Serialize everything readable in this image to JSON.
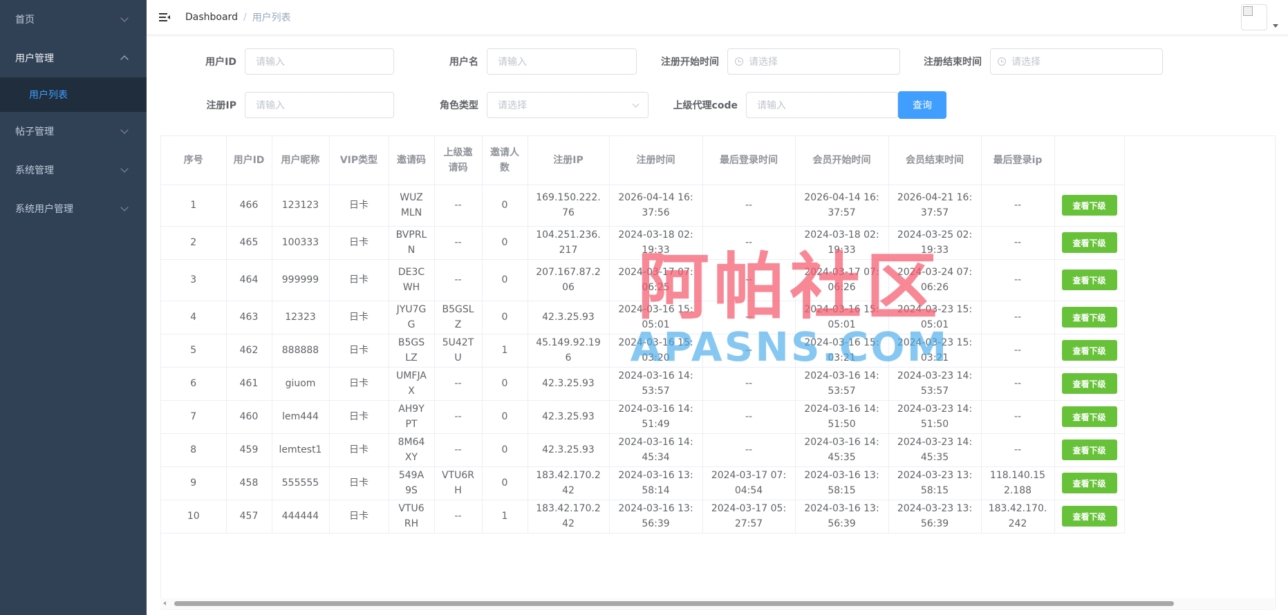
{
  "sidebar": {
    "items": [
      {
        "label": "首页"
      },
      {
        "label": "用户管理",
        "children": [
          {
            "label": "用户列表"
          }
        ]
      },
      {
        "label": "帖子管理"
      },
      {
        "label": "系统管理"
      },
      {
        "label": "系统用户管理"
      }
    ]
  },
  "navbar": {
    "breadcrumb": [
      "Dashboard",
      "/",
      "用户列表"
    ]
  },
  "filters": {
    "user_id": {
      "label": "用户ID",
      "placeholder": "请输入"
    },
    "username": {
      "label": "用户名",
      "placeholder": "请输入"
    },
    "reg_start": {
      "label": "注册开始时间",
      "placeholder": "请选择"
    },
    "reg_end": {
      "label": "注册结束时间",
      "placeholder": "请选择"
    },
    "reg_ip": {
      "label": "注册IP",
      "placeholder": "请输入"
    },
    "role_type": {
      "label": "角色类型",
      "placeholder": "请选择"
    },
    "agent_code": {
      "label": "上级代理code",
      "placeholder": "请输入"
    },
    "search_label": "查询"
  },
  "table": {
    "headers": [
      "序号",
      "用户ID",
      "用户昵称",
      "VIP类型",
      "邀请码",
      "上级邀请码",
      "邀请人数",
      "注册IP",
      "注册时间",
      "最后登录时间",
      "会员开始时间",
      "会员结束时间",
      "最后登录ip",
      ""
    ],
    "action_label": "查看下级",
    "rows": [
      [
        "1",
        "466",
        "123123",
        "日卡",
        "WUZMLN",
        "--",
        "0",
        "169.150.222.76",
        "2026-04-14 16:37:56",
        "--",
        "2026-04-14 16:37:57",
        "2026-04-21 16:37:57",
        "--"
      ],
      [
        "2",
        "465",
        "100333",
        "日卡",
        "BVPRLN",
        "--",
        "0",
        "104.251.236.217",
        "2024-03-18 02:19:33",
        "--",
        "2024-03-18 02:19:33",
        "2024-03-25 02:19:33",
        "--"
      ],
      [
        "3",
        "464",
        "999999",
        "日卡",
        "DE3CWH",
        "--",
        "0",
        "207.167.87.206",
        "2024-03-17 07:06:25",
        "--",
        "2024-03-17 07:06:26",
        "2024-03-24 07:06:26",
        "--"
      ],
      [
        "4",
        "463",
        "12323",
        "日卡",
        "JYU7GG",
        "B5GSLZ",
        "0",
        "42.3.25.93",
        "2024-03-16 15:05:01",
        "--",
        "2024-03-16 15:05:01",
        "2024-03-23 15:05:01",
        "--"
      ],
      [
        "5",
        "462",
        "888888",
        "日卡",
        "B5GSLZ",
        "5U42TU",
        "1",
        "45.149.92.196",
        "2024-03-16 15:03:20",
        "--",
        "2024-03-16 15:03:21",
        "2024-03-23 15:03:21",
        "--"
      ],
      [
        "6",
        "461",
        "giuom",
        "日卡",
        "UMFJAX",
        "--",
        "0",
        "42.3.25.93",
        "2024-03-16 14:53:57",
        "--",
        "2024-03-16 14:53:57",
        "2024-03-23 14:53:57",
        "--"
      ],
      [
        "7",
        "460",
        "lem444",
        "日卡",
        "AH9YPT",
        "--",
        "0",
        "42.3.25.93",
        "2024-03-16 14:51:49",
        "--",
        "2024-03-16 14:51:50",
        "2024-03-23 14:51:50",
        "--"
      ],
      [
        "8",
        "459",
        "lemtest1",
        "日卡",
        "8M64XY",
        "--",
        "0",
        "42.3.25.93",
        "2024-03-16 14:45:34",
        "--",
        "2024-03-16 14:45:35",
        "2024-03-23 14:45:35",
        "--"
      ],
      [
        "9",
        "458",
        "555555",
        "日卡",
        "549A9S",
        "VTU6RH",
        "0",
        "183.42.170.242",
        "2024-03-16 13:58:14",
        "2024-03-17 07:04:54",
        "2024-03-16 13:58:15",
        "2024-03-23 13:58:15",
        "118.140.152.188"
      ],
      [
        "10",
        "457",
        "444444",
        "日卡",
        "VTU6RH",
        "--",
        "1",
        "183.42.170.242",
        "2024-03-16 13:56:39",
        "2024-03-17 05:27:57",
        "2024-03-16 13:56:39",
        "2024-03-23 13:56:39",
        "183.42.170.242"
      ]
    ]
  },
  "watermark": {
    "cn": "阿帕社区",
    "en": "APASNS.COM"
  }
}
